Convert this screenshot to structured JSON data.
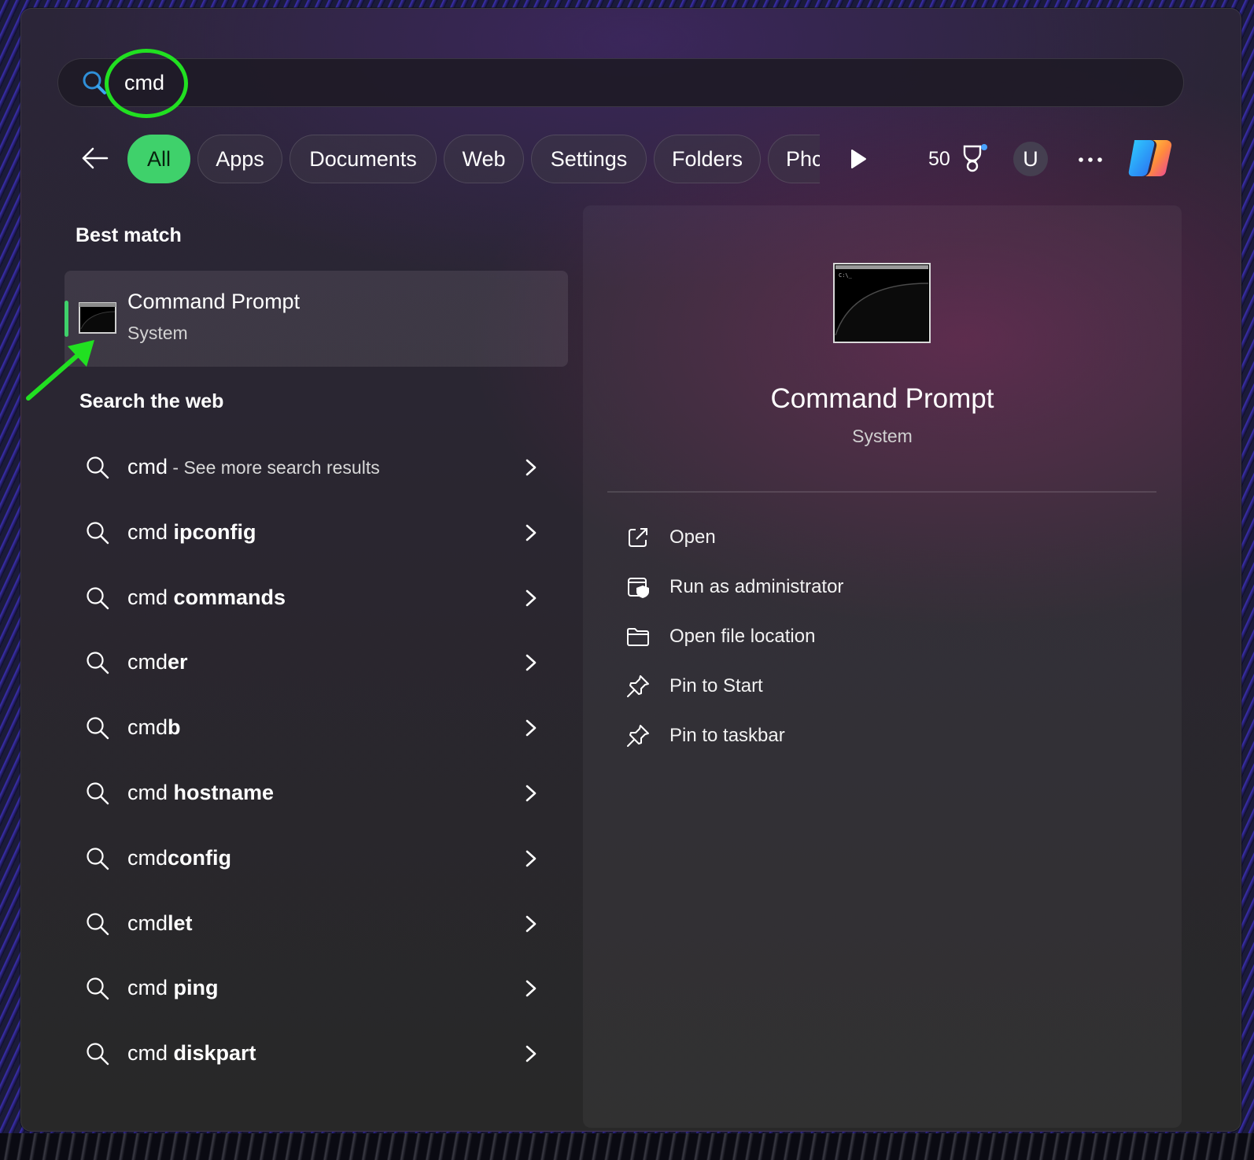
{
  "search": {
    "query": "cmd"
  },
  "filters": {
    "chips": [
      "All",
      "Apps",
      "Documents",
      "Web",
      "Settings",
      "Folders",
      "Phc"
    ],
    "points": "50",
    "avatar_initial": "U"
  },
  "best_match": {
    "heading": "Best match",
    "name": "Command Prompt",
    "type": "System"
  },
  "web": {
    "heading": "Search the web",
    "items": [
      {
        "prefix": "cmd",
        "bold": "",
        "suffix": " - See more search results"
      },
      {
        "prefix": "cmd ",
        "bold": "ipconfig",
        "suffix": ""
      },
      {
        "prefix": "cmd ",
        "bold": "commands",
        "suffix": ""
      },
      {
        "prefix": "cmd",
        "bold": "er",
        "suffix": ""
      },
      {
        "prefix": "cmd",
        "bold": "b",
        "suffix": ""
      },
      {
        "prefix": "cmd ",
        "bold": "hostname",
        "suffix": ""
      },
      {
        "prefix": "cmd",
        "bold": "config",
        "suffix": ""
      },
      {
        "prefix": "cmd",
        "bold": "let",
        "suffix": ""
      },
      {
        "prefix": "cmd ",
        "bold": "ping",
        "suffix": ""
      },
      {
        "prefix": "cmd ",
        "bold": "diskpart",
        "suffix": ""
      }
    ]
  },
  "preview": {
    "title": "Command Prompt",
    "subtitle": "System",
    "icon_text": "C:\\_",
    "actions": [
      {
        "label": "Open",
        "icon": "open-external-icon"
      },
      {
        "label": "Run as administrator",
        "icon": "shield-admin-icon"
      },
      {
        "label": "Open file location",
        "icon": "folder-icon"
      },
      {
        "label": "Pin to Start",
        "icon": "pin-icon"
      },
      {
        "label": "Pin to taskbar",
        "icon": "pin-icon"
      }
    ]
  },
  "colors": {
    "accent": "#3fd16b",
    "annotation": "#21e021"
  }
}
